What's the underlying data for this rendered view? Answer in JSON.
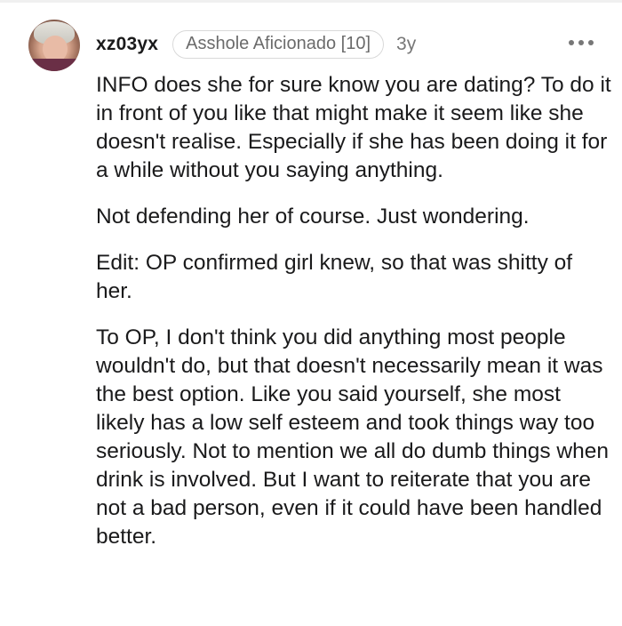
{
  "comment": {
    "username": "xz03yx",
    "flair": "Asshole Aficionado [10]",
    "age": "3y",
    "more_icon": "more-horizontal-icon",
    "avatar_icon": "user-avatar",
    "paragraphs": [
      "INFO does she for sure know you are dating? To do it in front of you like that might make it seem like she doesn't realise. Especially if she has been doing it for a while without you saying anything.",
      "Not defending her of course. Just wondering.",
      "Edit: OP confirmed girl knew, so that was shitty of her.",
      "To OP, I don't think you did anything most people wouldn't do, but that doesn't necessarily mean it was the best option. Like you said yourself, she most likely has a low self esteem and took things way too seriously. Not to mention we all do dumb things when drink is involved. But I want to reiterate that you are not a bad person, even if it could have been handled better."
    ]
  }
}
